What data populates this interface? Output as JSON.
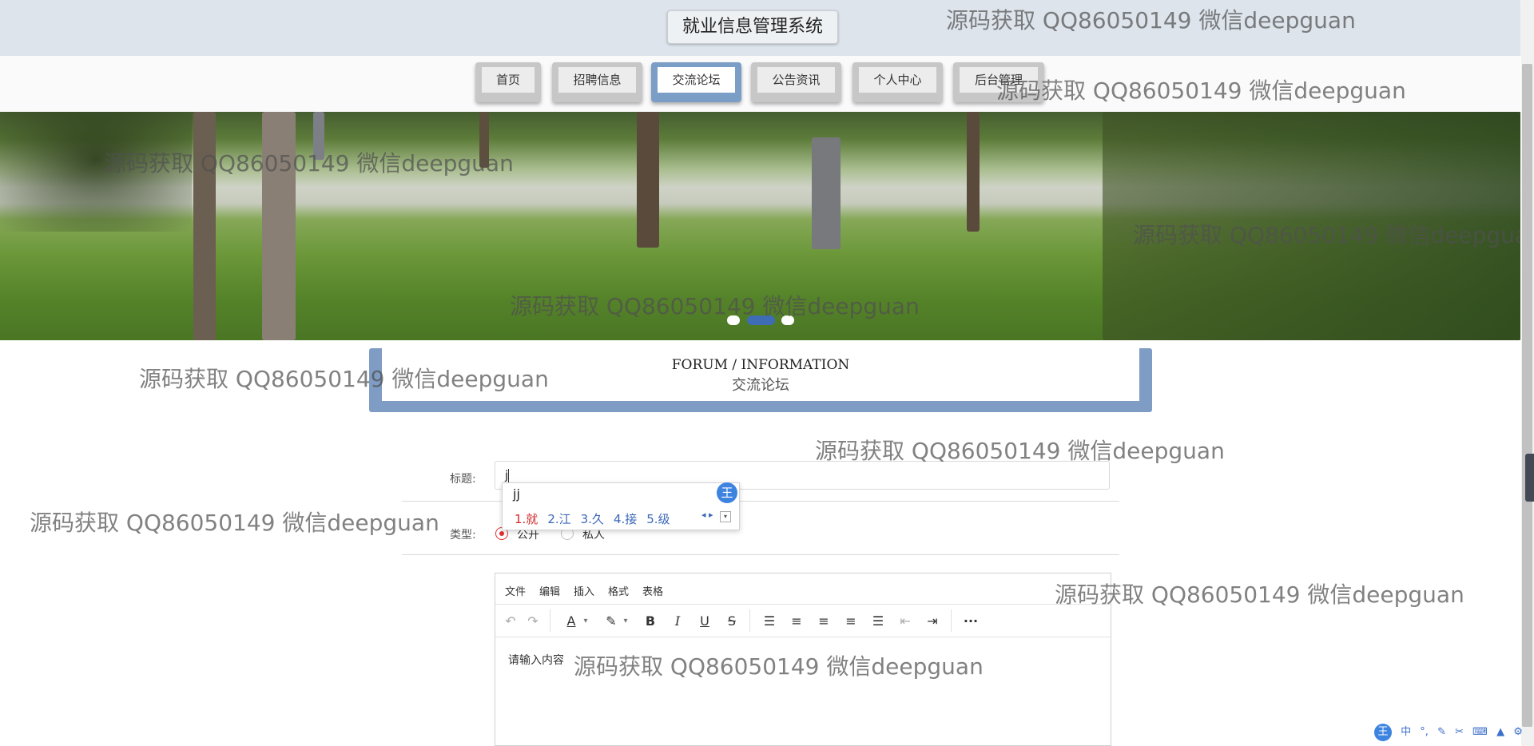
{
  "header": {
    "title": "就业信息管理系统"
  },
  "nav": {
    "items": [
      {
        "label": "首页"
      },
      {
        "label": "招聘信息"
      },
      {
        "label": "交流论坛"
      },
      {
        "label": "公告资讯"
      },
      {
        "label": "个人中心"
      },
      {
        "label": "后台管理"
      }
    ],
    "active": "交流论坛"
  },
  "banner": {
    "slides": 3,
    "active_slide": 2
  },
  "section": {
    "title_en": "FORUM / INFORMATION",
    "title_cn": "交流论坛"
  },
  "form": {
    "title_label": "标题:",
    "title_value": "j",
    "type_label": "类型:",
    "type_options": [
      "公开",
      "私人"
    ],
    "type_selected": "公开"
  },
  "ime": {
    "pinyin": "jj",
    "candidates": [
      "1.就",
      "2.江",
      "3.久",
      "4.接",
      "5.级"
    ],
    "badge": "王",
    "arrows": "◂ ▸",
    "expand": "▾"
  },
  "editor": {
    "menu": [
      "文件",
      "编辑",
      "插入",
      "格式",
      "表格"
    ],
    "toolbar": [
      "undo-icon",
      "redo-icon",
      "font-color-icon",
      "highlight-icon",
      "bold-icon",
      "italic-icon",
      "underline-icon",
      "strikethrough-icon",
      "list-icon",
      "align-left-icon",
      "align-center-icon",
      "align-right-icon",
      "justify-icon",
      "outdent-icon",
      "indent-icon",
      "more-icon"
    ],
    "placeholder": "请输入内容"
  },
  "watermark": "源码获取 QQ86050149 微信deepguan",
  "ime_status": {
    "logo": "王",
    "mode": "中"
  },
  "colors": {
    "accent": "#7f9cc4",
    "nav_active": "#7b9ec6",
    "radio": "#e03131",
    "ime_blue": "#3c68b8"
  }
}
